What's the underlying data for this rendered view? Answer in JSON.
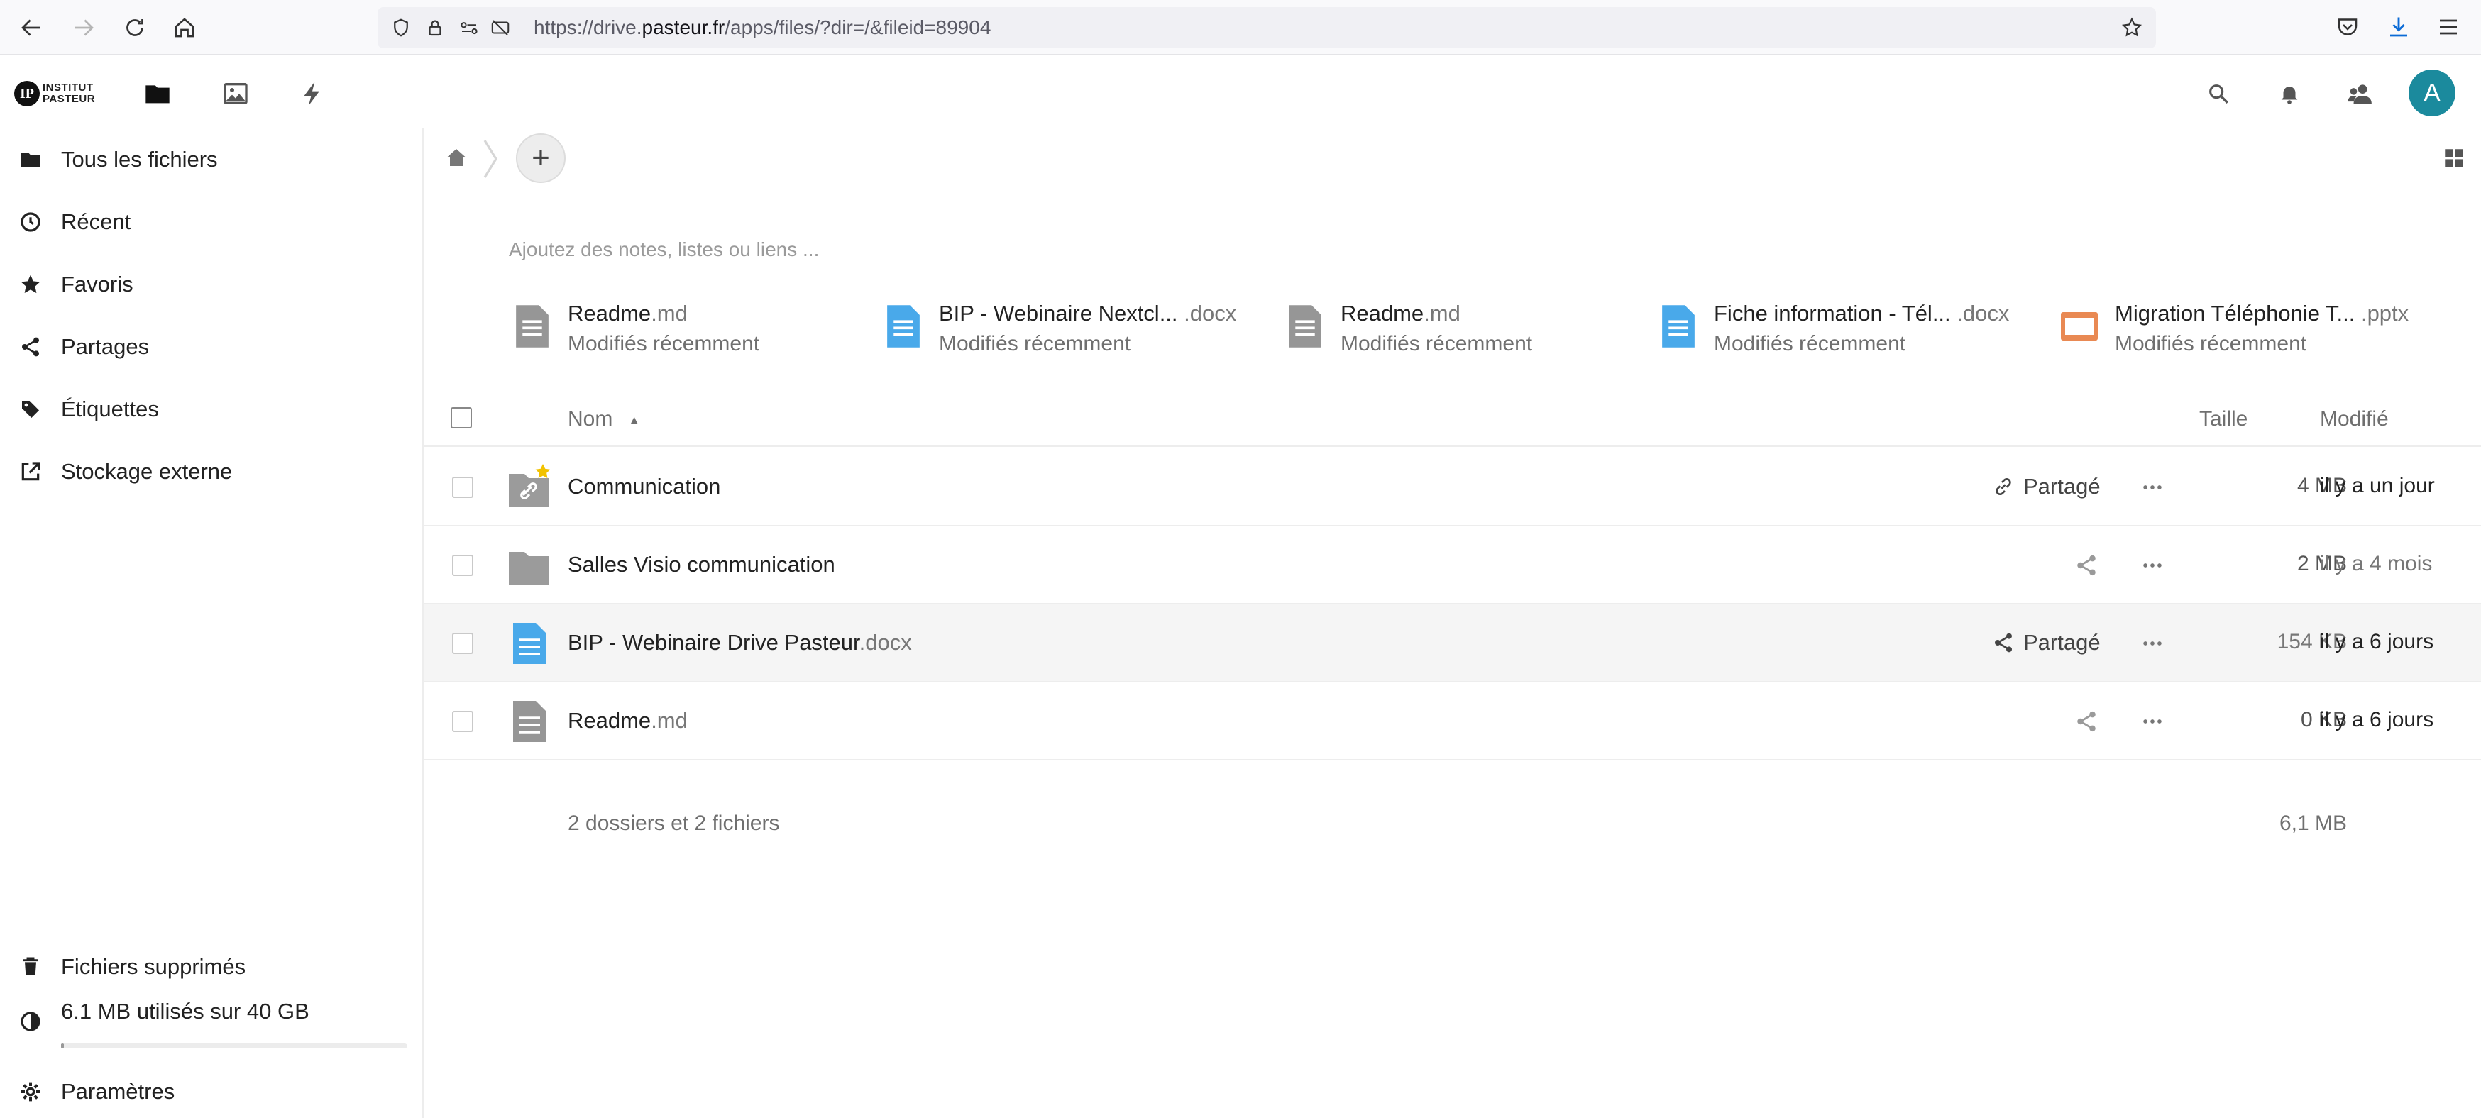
{
  "browser": {
    "url_prefix": "https://drive.",
    "url_host": "pasteur.fr",
    "url_path": "/apps/files/?dir=/&fileid=89904"
  },
  "header": {
    "logo_line1": "INSTITUT",
    "logo_line2": "PASTEUR",
    "avatar_letter": "A",
    "accent_color": "#1b8a9d"
  },
  "sidebar": {
    "items": [
      {
        "label": "Tous les fichiers",
        "icon": "folder-icon"
      },
      {
        "label": "Récent",
        "icon": "clock-icon"
      },
      {
        "label": "Favoris",
        "icon": "star-icon"
      },
      {
        "label": "Partages",
        "icon": "share-icon"
      },
      {
        "label": "Étiquettes",
        "icon": "tag-icon"
      },
      {
        "label": "Stockage externe",
        "icon": "external-link-icon"
      }
    ],
    "trash_label": "Fichiers supprimés",
    "quota_label": "6.1 MB utilisés sur 40 GB",
    "quota_fraction": 0.00015,
    "settings_label": "Paramètres"
  },
  "main": {
    "notes_placeholder": "Ajoutez des notes, listes ou liens ...",
    "recent": [
      {
        "name": "Readme",
        "ext": ".md",
        "sub": "Modifiés récemment",
        "type": "text"
      },
      {
        "name": "BIP - Webinaire Nextcl... ",
        "ext": ".docx",
        "sub": "Modifiés récemment",
        "type": "doc"
      },
      {
        "name": "Readme",
        "ext": ".md",
        "sub": "Modifiés récemment",
        "type": "text"
      },
      {
        "name": "Fiche information - Tél... ",
        "ext": ".docx",
        "sub": "Modifiés récemment",
        "type": "doc"
      },
      {
        "name": "Migration Téléphonie T... ",
        "ext": ".pptx",
        "sub": "Modifiés récemment",
        "type": "slides"
      }
    ],
    "columns": {
      "name": "Nom",
      "size": "Taille",
      "modified": "Modifié"
    },
    "rows": [
      {
        "name": "Communication",
        "ext": "",
        "share_label": "Partagé",
        "size": "4 MB",
        "modified": "il y a un jour"
      },
      {
        "name": "Salles Visio communication",
        "ext": "",
        "share_label": "",
        "size": "2 MB",
        "modified": "il y a 4 mois"
      },
      {
        "name": "BIP - Webinaire Drive Pasteur",
        "ext": ".docx",
        "share_label": "Partagé",
        "size": "154 KB",
        "modified": "il y a 6 jours"
      },
      {
        "name": "Readme",
        "ext": ".md",
        "share_label": "",
        "size": "0 KB",
        "modified": "il y a 6 jours"
      }
    ],
    "summary_label": "2 dossiers et 2 fichiers",
    "summary_size": "6,1 MB"
  }
}
